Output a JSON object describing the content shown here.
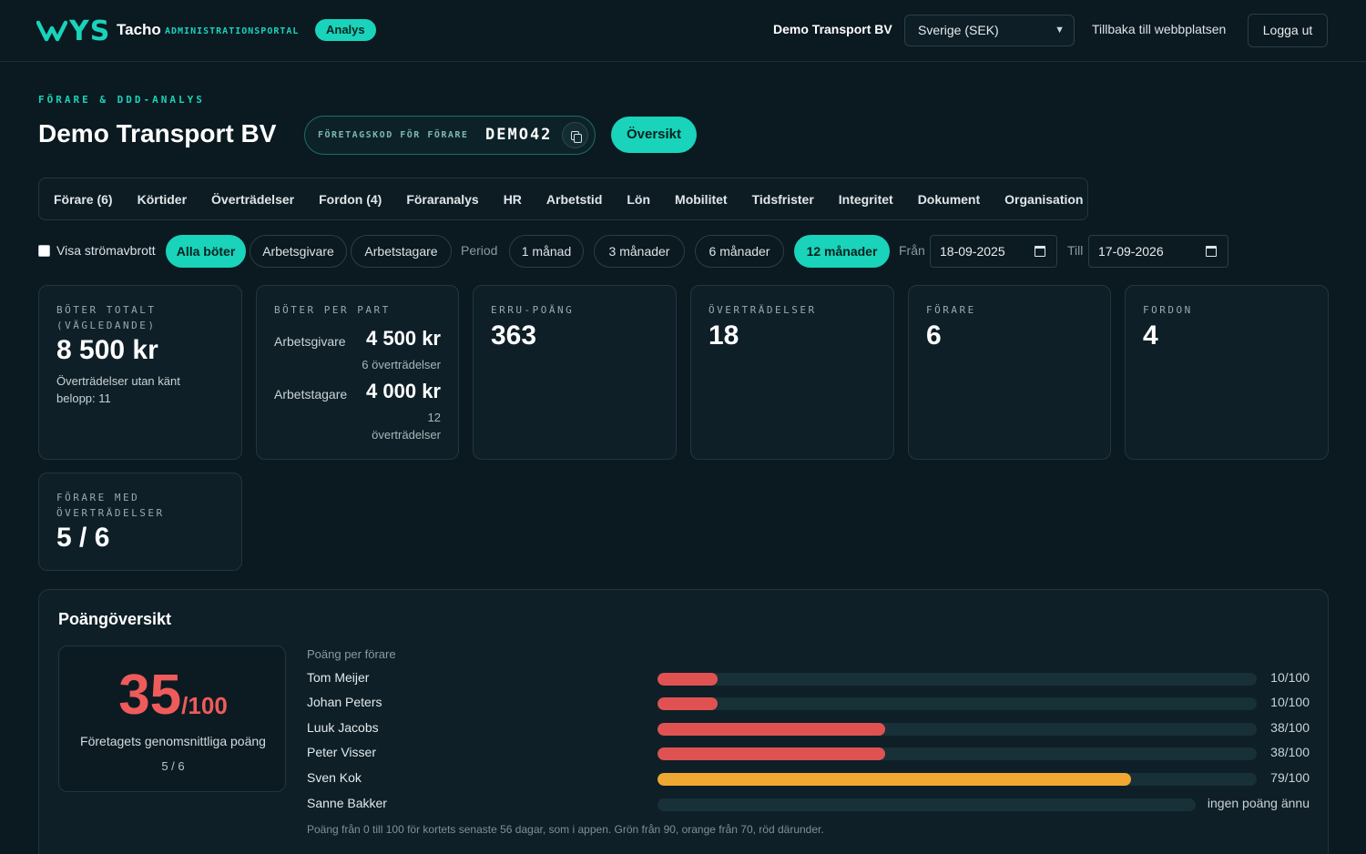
{
  "header": {
    "logo_letters": "YS",
    "brand": "Tacho",
    "brand_sub": "ADMINISTRATIONSPORTAL",
    "badge": "Analys",
    "company": "Demo Transport BV",
    "country_select": "Sverige (SEK)",
    "back_link": "Tillbaka till webbplatsen",
    "logout": "Logga ut"
  },
  "title_area": {
    "eyebrow": "FÖRARE & DDD-ANALYS",
    "title": "Demo Transport BV",
    "code_label": "FÖRETAGSKOD FÖR FÖRARE",
    "code_value": "DEMO42",
    "overview_button": "Översikt"
  },
  "tabs": [
    "Förare (6)",
    "Körtider",
    "Överträdelser",
    "Fordon (4)",
    "Föraranalys",
    "HR",
    "Arbetstid",
    "Lön",
    "Mobilitet",
    "Tidsfrister",
    "Integritet",
    "Dokument",
    "Organisation"
  ],
  "filters": {
    "checkbox_label": "Visa strömavbrott",
    "checkbox_checked": false,
    "fine_types": [
      "Alla böter",
      "Arbetsgivare",
      "Arbetstagare"
    ],
    "active_fine_type": "Alla böter",
    "period_label": "Period",
    "periods": [
      "1 månad",
      "3 månader",
      "6 månader",
      "12 månader"
    ],
    "active_period": "12 månader",
    "from_label": "Från",
    "from_date": "18-09-2025",
    "to_label": "Till",
    "to_date": "17-09-2026"
  },
  "stats": {
    "total": {
      "label_line1": "BÖTER TOTALT",
      "label_line2": "(VÄGLEDANDE)",
      "value": "8 500 kr",
      "sub": "Överträdelser utan känt belopp: 11"
    },
    "per_part": {
      "label": "BÖTER PER PART",
      "employer_label": "Arbetsgivare",
      "employer_value": "4 500 kr",
      "employer_sub": "6 överträdelser",
      "employee_label": "Arbetstagare",
      "employee_value": "4 000 kr",
      "employee_sub_line1": "12",
      "employee_sub_line2": "överträdelser"
    },
    "erru": {
      "label": "ERRU-POÄNG",
      "value": "363"
    },
    "violations": {
      "label": "ÖVERTRÄDELSER",
      "value": "18"
    },
    "drivers": {
      "label": "FÖRARE",
      "value": "6"
    },
    "vehicles": {
      "label": "FORDON",
      "value": "4"
    },
    "drivers_with_violations": {
      "label_line1": "FÖRARE MED",
      "label_line2": "ÖVERTRÄDELSER",
      "value": "5 / 6"
    }
  },
  "score_panel": {
    "title": "Poängöversikt",
    "avg_score": "35",
    "avg_denominator": "/100",
    "avg_label": "Företagets genomsnittliga poäng",
    "avg_count": "5 / 6",
    "list_title": "Poäng per förare",
    "drivers": [
      {
        "name": "Tom Meijer",
        "score": 10,
        "label": "10/100",
        "color": "#e05252"
      },
      {
        "name": "Johan Peters",
        "score": 10,
        "label": "10/100",
        "color": "#e05252"
      },
      {
        "name": "Luuk Jacobs",
        "score": 38,
        "label": "38/100",
        "color": "#e05252"
      },
      {
        "name": "Peter Visser",
        "score": 38,
        "label": "38/100",
        "color": "#e05252"
      },
      {
        "name": "Sven Kok",
        "score": 79,
        "label": "79/100",
        "color": "#f0a832"
      },
      {
        "name": "Sanne Bakker",
        "score": null,
        "label": "ingen poäng ännu",
        "color": "#183038"
      }
    ],
    "footnote": "Poäng från 0 till 100 för kortets senaste 56 dagar, som i appen. Grön från 90, orange från 70, röd därunder."
  }
}
